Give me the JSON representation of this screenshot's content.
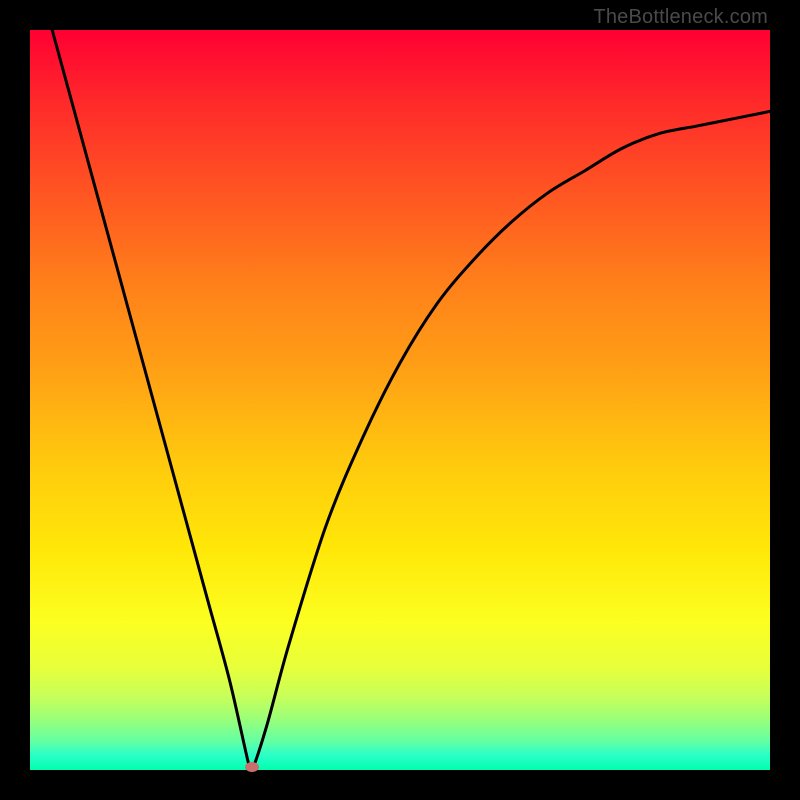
{
  "watermark": "TheBottleneck.com",
  "chart_data": {
    "type": "line",
    "title": "",
    "xlabel": "",
    "ylabel": "",
    "xlim": [
      0,
      1
    ],
    "ylim": [
      0,
      1
    ],
    "grid": false,
    "legend": false,
    "background": "rainbow-vertical-gradient",
    "series": [
      {
        "name": "bottleneck-curve",
        "color": "#000000",
        "x": [
          0.03,
          0.06,
          0.09,
          0.12,
          0.15,
          0.18,
          0.21,
          0.24,
          0.27,
          0.295,
          0.3,
          0.32,
          0.35,
          0.4,
          0.45,
          0.5,
          0.55,
          0.6,
          0.65,
          0.7,
          0.75,
          0.8,
          0.85,
          0.9,
          0.95,
          1.0
        ],
        "y": [
          1.0,
          0.89,
          0.78,
          0.67,
          0.56,
          0.45,
          0.34,
          0.23,
          0.12,
          0.01,
          0.0,
          0.06,
          0.17,
          0.33,
          0.45,
          0.55,
          0.63,
          0.69,
          0.74,
          0.78,
          0.81,
          0.84,
          0.86,
          0.87,
          0.88,
          0.89
        ]
      }
    ],
    "min_point": {
      "x": 0.3,
      "y": 0.0
    },
    "gradient_stops": [
      {
        "pos": 0.0,
        "color": "#ff0033"
      },
      {
        "pos": 0.5,
        "color": "#ffc000"
      },
      {
        "pos": 0.8,
        "color": "#fcff20"
      },
      {
        "pos": 1.0,
        "color": "#00ffb0"
      }
    ]
  }
}
